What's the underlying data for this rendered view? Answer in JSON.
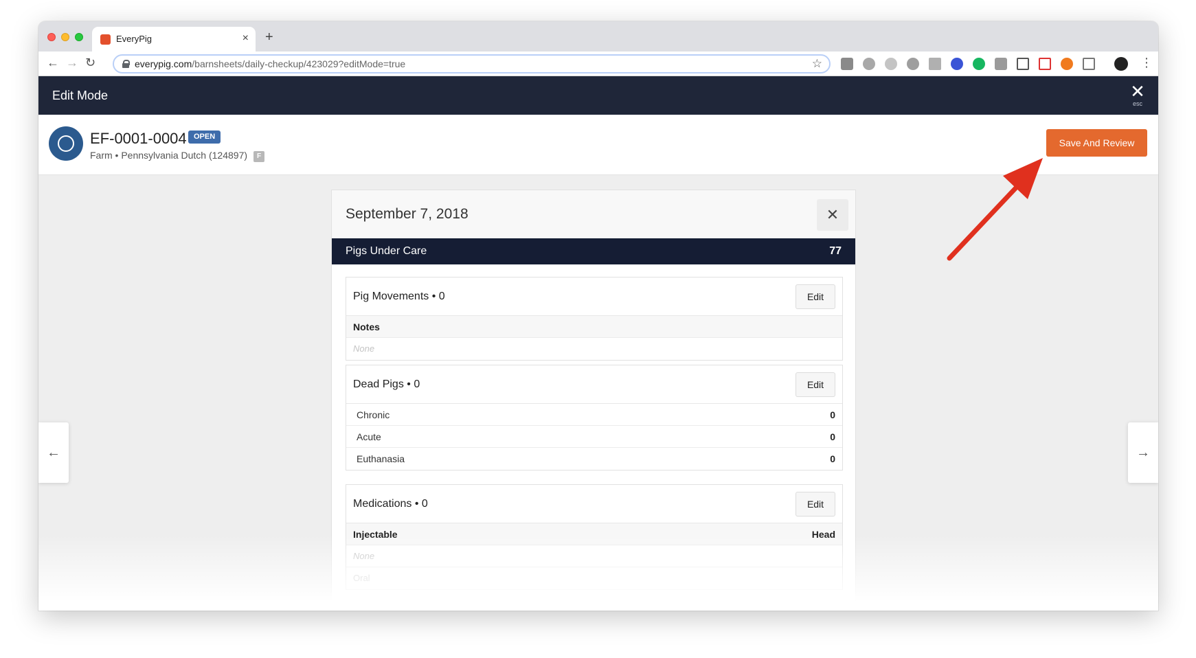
{
  "browser": {
    "tab_title": "EveryPig",
    "url_domain": "everypig.com",
    "url_path": "/barnsheets/daily-checkup/423029?editMode=true",
    "tab_close_glyph": "×",
    "new_tab_glyph": "+"
  },
  "header": {
    "title": "Edit Mode",
    "close_label": "esc"
  },
  "farm": {
    "id": "EF-0001-0004",
    "status_badge": "OPEN",
    "subtitle": "Farm • Pennsylvania Dutch (124897)",
    "type_badge": "F",
    "save_label": "Save And Review"
  },
  "card": {
    "date": "September 7, 2018",
    "pigs_under_care_label": "Pigs Under Care",
    "pigs_under_care_value": "77",
    "edit_label": "Edit",
    "pig_movements": {
      "title": "Pig Movements • 0",
      "notes_label": "Notes",
      "notes_value": "None"
    },
    "dead_pigs": {
      "title": "Dead Pigs • 0",
      "rows": [
        {
          "label": "Chronic",
          "value": "0"
        },
        {
          "label": "Acute",
          "value": "0"
        },
        {
          "label": "Euthanasia",
          "value": "0"
        }
      ]
    },
    "medications": {
      "title": "Medications • 0",
      "injectable_label": "Injectable",
      "head_label": "Head",
      "injectable_value": "None",
      "oral_label": "Oral"
    }
  },
  "colors": {
    "header_bg": "#1f2639",
    "save_button": "#e4692e",
    "open_badge": "#3e6cab",
    "annotation_arrow": "#e0301e"
  }
}
